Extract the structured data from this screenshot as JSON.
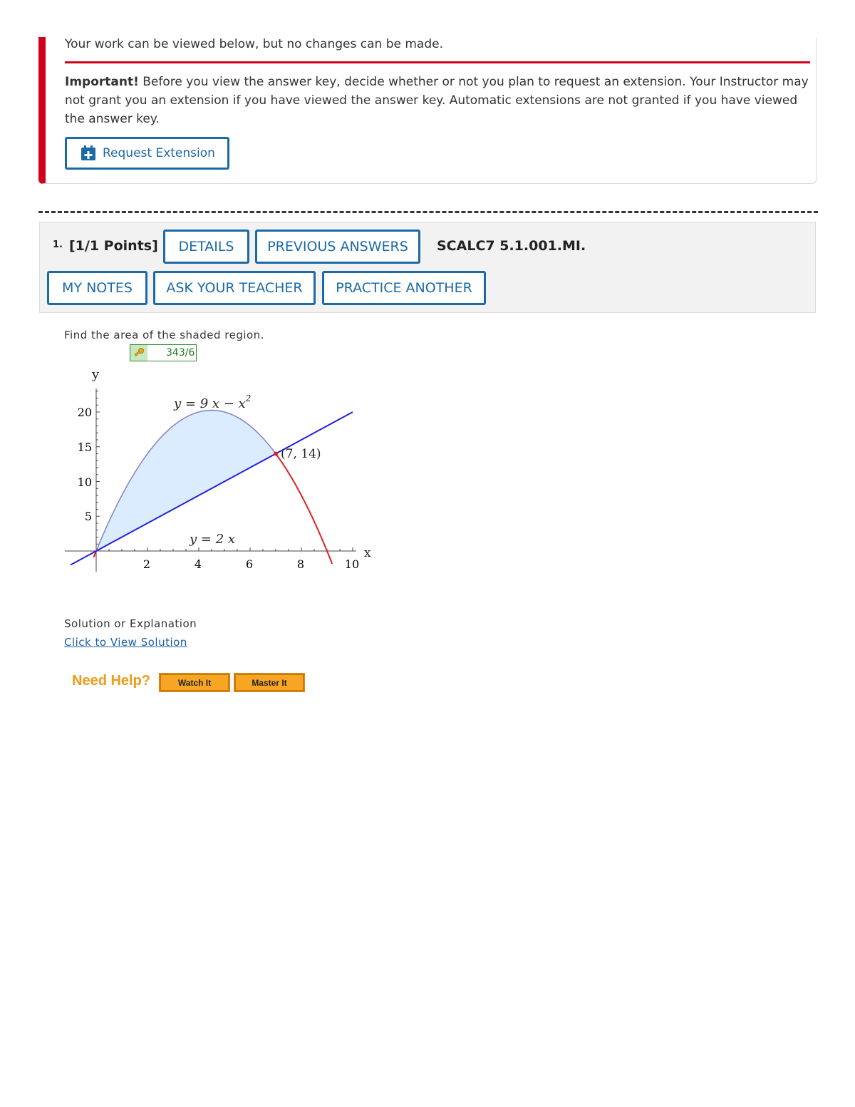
{
  "alert": {
    "message": "Your work can be viewed below, but no changes can be made.",
    "important_label": "Important!",
    "important_text": " Before you view the answer key, decide whether or not you plan to request an extension. Your Instructor may not grant you an extension if you have viewed the answer key. Automatic extensions are not granted if you have viewed the answer key.",
    "request_extension_label": "Request Extension",
    "accent_color": "#d0021b"
  },
  "question": {
    "number": "1.",
    "points": "[1/1 Points]",
    "source": "SCALC7 5.1.001.MI.",
    "buttons": {
      "details": "DETAILS",
      "previous_answers": "PREVIOUS ANSWERS",
      "my_notes": "MY NOTES",
      "ask_teacher": "ASK YOUR TEACHER",
      "practice_another": "PRACTICE ANOTHER"
    },
    "prompt": "Find the area of the shaded region.",
    "answer": "343/6",
    "button_color": "#1b6aa5"
  },
  "graph": {
    "y_axis_label": "y",
    "x_axis_label": "x",
    "x_ticks": [
      "2",
      "4",
      "6",
      "8",
      "10"
    ],
    "y_ticks": [
      "5",
      "10",
      "15",
      "20"
    ],
    "curve_label_parabola": "y = 9 x − x",
    "curve_label_parabola_exp": "2",
    "curve_label_line": "y = 2 x",
    "intersection_label": "(7, 14)",
    "parabola_color": "#e02020",
    "line_color": "#2020e0",
    "fill_color": "#dcecff"
  },
  "solution": {
    "label": "Solution or Explanation",
    "link": "Click to View Solution"
  },
  "help": {
    "label": "Need Help?",
    "watch_it": "Watch It",
    "master_it": "Master It",
    "button_color": "#f6a623"
  }
}
